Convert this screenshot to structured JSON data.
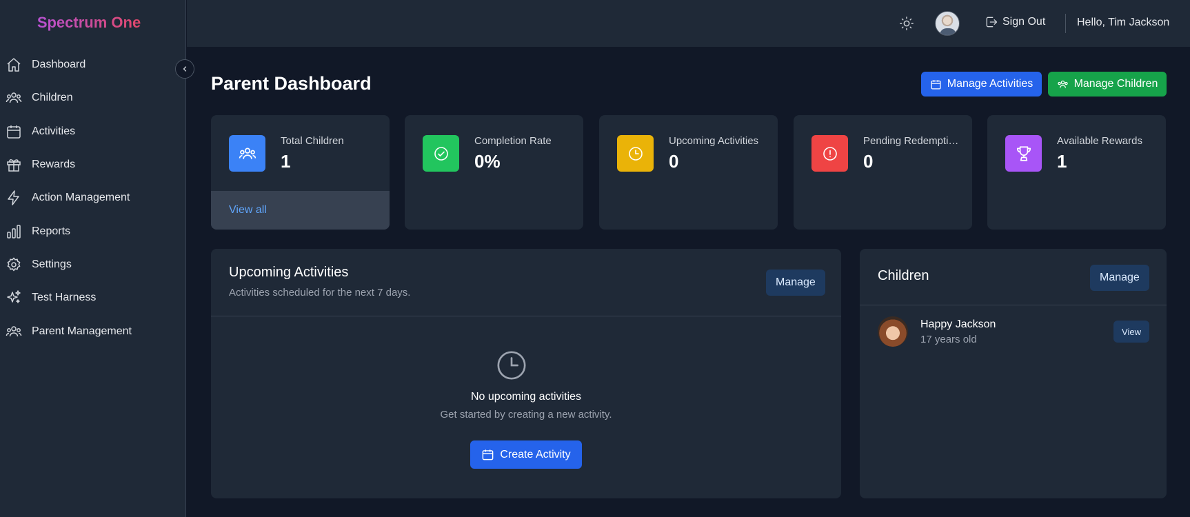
{
  "app": {
    "title": "Spectrum One"
  },
  "sidebar": {
    "items": [
      {
        "label": "Dashboard",
        "icon": "home-icon"
      },
      {
        "label": "Children",
        "icon": "users-icon"
      },
      {
        "label": "Activities",
        "icon": "calendar-icon"
      },
      {
        "label": "Rewards",
        "icon": "gift-icon"
      },
      {
        "label": "Action Management",
        "icon": "lightning-icon"
      },
      {
        "label": "Reports",
        "icon": "bar-chart-icon"
      },
      {
        "label": "Settings",
        "icon": "gear-icon"
      },
      {
        "label": "Test Harness",
        "icon": "sparkles-icon"
      },
      {
        "label": "Parent Management",
        "icon": "users-icon"
      }
    ]
  },
  "topbar": {
    "signout_label": "Sign Out",
    "greeting": "Hello, Tim Jackson"
  },
  "page": {
    "title": "Parent Dashboard",
    "manage_activities_label": "Manage Activities",
    "manage_children_label": "Manage Children"
  },
  "stats": [
    {
      "label": "Total Children",
      "value": "1",
      "color": "#3b82f6",
      "icon": "users-icon",
      "footer": "View all"
    },
    {
      "label": "Completion Rate",
      "value": "0%",
      "color": "#22c55e",
      "icon": "check-circle-icon"
    },
    {
      "label": "Upcoming Activities",
      "value": "0",
      "color": "#eab308",
      "icon": "clock-icon"
    },
    {
      "label": "Pending Redemptions",
      "value": "0",
      "color": "#ef4444",
      "icon": "alert-circle-icon"
    },
    {
      "label": "Available Rewards",
      "value": "1",
      "color": "#a855f7",
      "icon": "trophy-icon"
    }
  ],
  "upcoming": {
    "title": "Upcoming Activities",
    "subtitle": "Activities scheduled for the next 7 days.",
    "manage_label": "Manage",
    "empty_title": "No upcoming activities",
    "empty_subtitle": "Get started by creating a new activity.",
    "create_label": "Create Activity"
  },
  "children_panel": {
    "title": "Children",
    "manage_label": "Manage",
    "children": [
      {
        "name": "Happy Jackson",
        "age": "17 years old",
        "view_label": "View"
      }
    ]
  }
}
